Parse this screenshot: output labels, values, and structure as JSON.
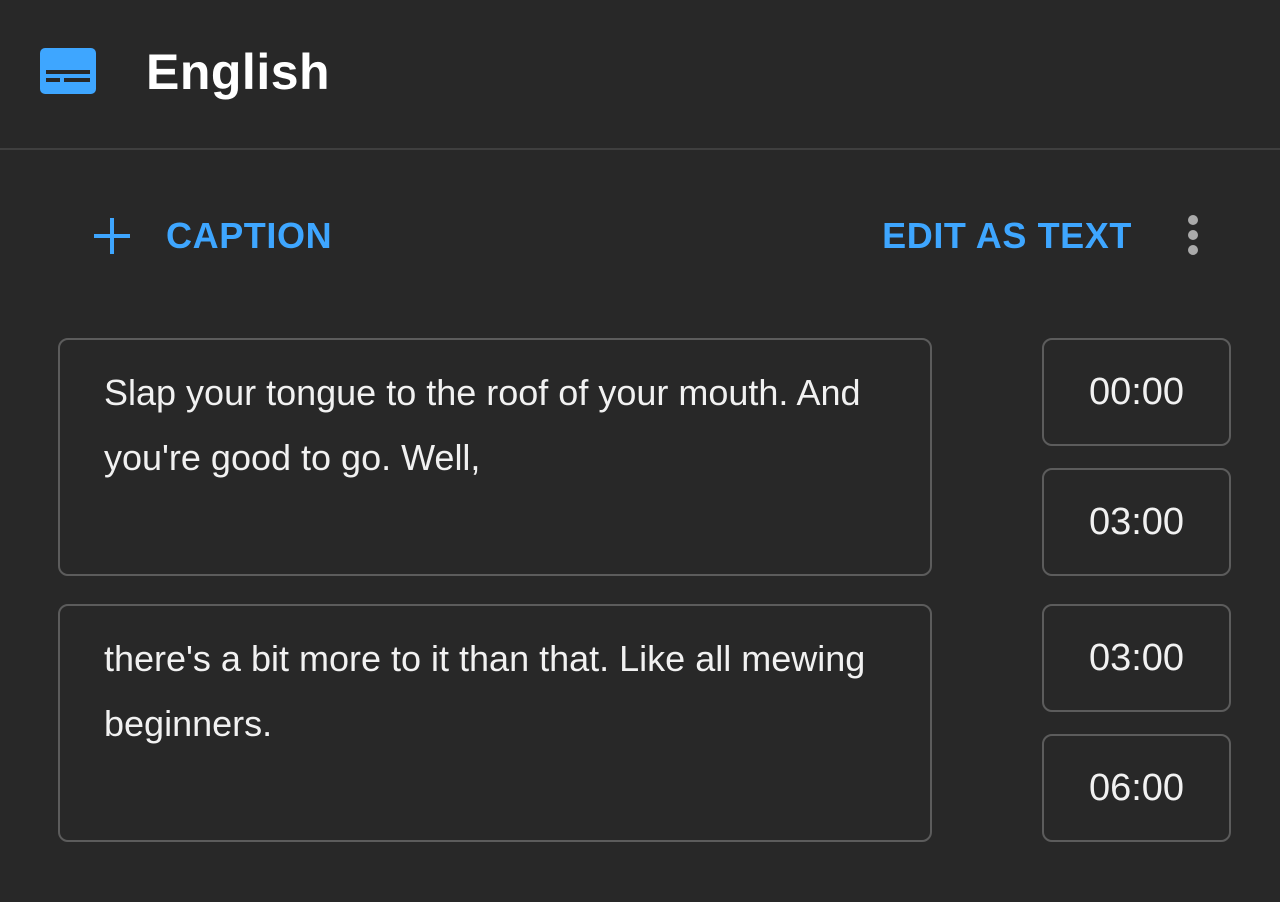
{
  "header": {
    "title": "English",
    "icon": "subtitles-icon"
  },
  "toolbar": {
    "add_caption_label": "CAPTION",
    "add_icon": "plus-icon",
    "edit_as_text_label": "EDIT AS TEXT",
    "more_icon": "more-vert-icon"
  },
  "captions": [
    {
      "text": "Slap your tongue to the roof of your mouth. And you're good to go. Well,",
      "start": "00:00",
      "end": "03:00"
    },
    {
      "text": "there's a bit more to it than that. Like all mewing beginners.",
      "start": "03:00",
      "end": "06:00"
    }
  ],
  "colors": {
    "background": "#282828",
    "accent": "#3ea6ff",
    "border": "#5c5c5c",
    "text": "#f1f1f1"
  }
}
